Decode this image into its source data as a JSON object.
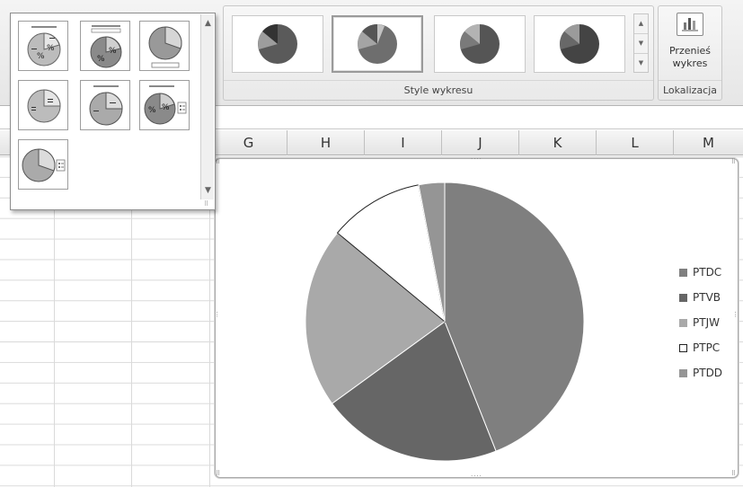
{
  "ribbon": {
    "styles_group_label": "Style wykresu",
    "location_group_label": "Lokalizacja",
    "move_chart_label_line1": "Przenieś",
    "move_chart_label_line2": "wykres"
  },
  "grid": {
    "columns": [
      "G",
      "H",
      "I",
      "J",
      "K",
      "L",
      "M"
    ]
  },
  "chart_data": {
    "type": "pie",
    "categories": [
      "PTDC",
      "PTVB",
      "PTJW",
      "PTPC",
      "PTDD"
    ],
    "values": [
      44,
      21,
      21,
      11,
      3
    ],
    "colors": [
      "#7f7f7f",
      "#666666",
      "#a9a9a9",
      "#ffffff",
      "#959595"
    ],
    "legend_position": "right"
  },
  "icons": {
    "move_chart": "move-chart-icon",
    "scroll_up": "scroll-up-icon",
    "scroll_down": "scroll-down-icon",
    "more": "more-styles-icon"
  }
}
